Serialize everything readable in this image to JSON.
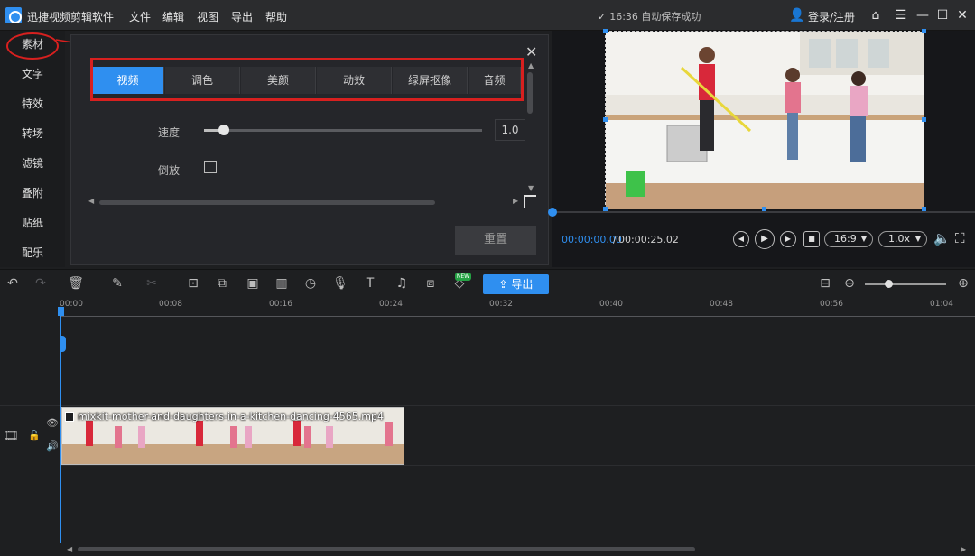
{
  "titlebar": {
    "app_title": "迅捷视频剪辑软件",
    "menu": [
      "文件",
      "编辑",
      "视图",
      "导出",
      "帮助"
    ],
    "autosave": "16:36 自动保存成功",
    "login": "登录/注册"
  },
  "sidebar": {
    "items": [
      "素材",
      "文字",
      "特效",
      "转场",
      "滤镜",
      "叠附",
      "贴纸",
      "配乐"
    ]
  },
  "panel": {
    "tabs": [
      "视频",
      "调色",
      "美颜",
      "动效",
      "绿屏抠像",
      "音频"
    ],
    "active_tab": "视频",
    "speed_label": "速度",
    "speed_value": "1.0",
    "speed_level": 0.07,
    "reverse_label": "倒放",
    "reset_button": "重置"
  },
  "preview": {
    "time_current": "00:00:00.00",
    "time_separator": "/",
    "time_total": "00:00:25.02",
    "aspect": "16:9",
    "rate": "1.0x"
  },
  "toolbar": {
    "export_label": "导出",
    "new_badge": "NEW"
  },
  "timeline": {
    "ticks": [
      "00:00",
      "00:08",
      "00:16",
      "00:24",
      "00:32",
      "00:40",
      "00:48",
      "00:56",
      "01:04"
    ],
    "clip_name": "mixkit-mother-and-daughters-in-a-kitchen-dancing-4565.mp4"
  },
  "colors": {
    "accent": "#2f8ff0",
    "annotation_red": "#d8201f",
    "background": "#1e1f21"
  }
}
